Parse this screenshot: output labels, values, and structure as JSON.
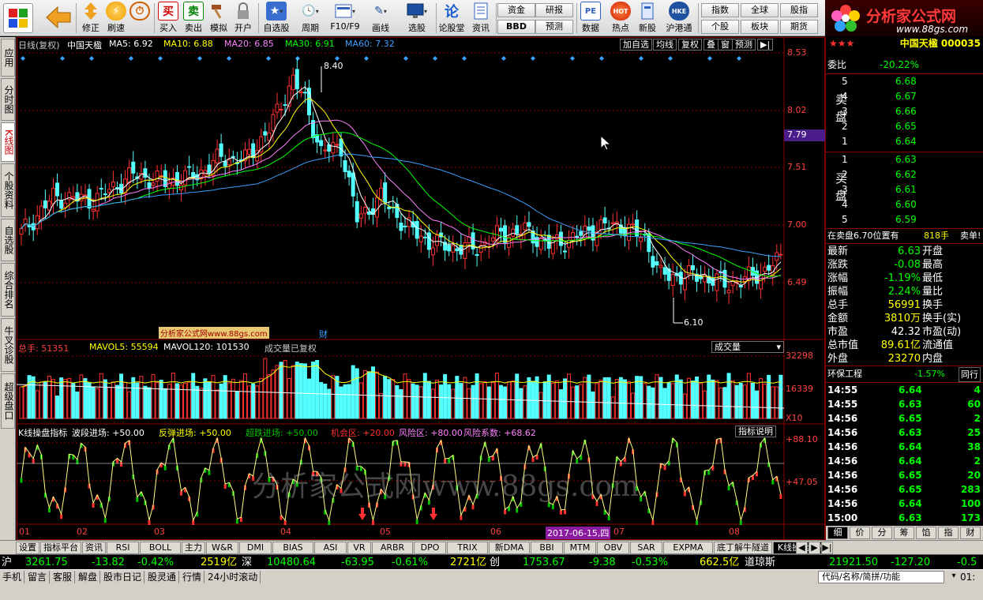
{
  "toolbar": {
    "buttons": [
      {
        "label": "修正",
        "icon": "up-arrow-icon"
      },
      {
        "label": "刷速",
        "icon": "lightning-icon"
      },
      {
        "label": "买入",
        "icon": "buy-icon",
        "glyph": "买"
      },
      {
        "label": "卖出",
        "icon": "sell-icon",
        "glyph": "卖"
      },
      {
        "label": "模拟",
        "icon": "hammer-icon"
      },
      {
        "label": "开户",
        "icon": "lock-icon"
      },
      {
        "label": "自选股",
        "icon": "star-icon"
      },
      {
        "label": "周期",
        "icon": "clock-icon"
      },
      {
        "label": "F10/F9",
        "icon": "document-icon"
      },
      {
        "label": "画线",
        "icon": "pen-icon"
      },
      {
        "label": "选股",
        "icon": "monitor-icon"
      },
      {
        "label": "论股堂",
        "icon": "forum-icon",
        "glyph": "论"
      },
      {
        "label": "资讯",
        "icon": "news-icon"
      },
      {
        "label": "数据",
        "icon": "pe-icon",
        "glyph": "PE"
      },
      {
        "label": "热点",
        "icon": "hot-icon",
        "glyph": "HOT"
      },
      {
        "label": "新股",
        "icon": "new-stock-icon"
      },
      {
        "label": "沪港通",
        "icon": "hk-connect-icon",
        "glyph": "HKE"
      }
    ],
    "small_buttons": [
      "资金",
      "研报",
      "BBD",
      "预测",
      "指数",
      "全球",
      "股指",
      "个股",
      "板块",
      "期货"
    ],
    "logo_title": "分析家公式网",
    "logo_url": "www.88gs.com"
  },
  "left_tabs": [
    "应用",
    "分时图",
    "K线图",
    "个股资料",
    "自选股",
    "综合排名",
    "牛叉诊股",
    "超级盘口"
  ],
  "chart": {
    "header": {
      "mode": "日线(复权)",
      "name": "中国天楹",
      "ma5": "MA5: 6.92",
      "ma10": "MA10: 6.88",
      "ma20": "MA20: 6.85",
      "ma30": "MA30: 6.91",
      "ma60": "MA60: 7.32"
    },
    "header_buttons": [
      "加自选",
      "均线",
      "复权",
      "叠",
      "窗",
      "预测"
    ],
    "price_axis": [
      "8.53",
      "8.02",
      "7.51",
      "7.00",
      "6.49"
    ],
    "current_price_tag": "7.79",
    "high_label": "8.40",
    "low_label": "6.10",
    "watermark_box": "分析家公式网www.88gs.com",
    "finance_marker": "财",
    "volume": {
      "total": "总手: 51351",
      "mavol5": "MAVOL5: 55594",
      "mavol120": "MAVOL120: 101530",
      "note": "成交量已复权",
      "selector": "成交量",
      "axis": [
        "32298",
        "16339",
        "X10"
      ]
    },
    "indicator": {
      "name": "K线操盘指标",
      "wave": "波段进场: +50.00",
      "rebound": "反弹进场: +50.00",
      "super": "超跌进场: +50.00",
      "chance": "机会区: +20.00",
      "risk": "风险区: +80.00",
      "coef": "风险系数: +68.62",
      "help": "指标说明",
      "axis": [
        "+88.10",
        "+47.05"
      ],
      "watermark": "分析家公式网www.88gs.com"
    },
    "x_axis": [
      "01",
      "02",
      "03",
      "04",
      "05",
      "06",
      "07",
      "08"
    ],
    "cursor_date": "2017-06-15,四"
  },
  "chart_data": {
    "type": "candlestick",
    "symbol": "中国天楹",
    "ylim": [
      6.0,
      8.6
    ],
    "high": 8.4,
    "low": 6.1,
    "ma": {
      "MA5": 6.92,
      "MA10": 6.88,
      "MA20": 6.85,
      "MA30": 6.91,
      "MA60": 7.32
    }
  },
  "right_panel": {
    "title": "中国天楹 000035",
    "weibi_label": "委比",
    "weibi_value": "-20.22%",
    "sell_label": "卖盘",
    "buy_label": "买盘",
    "asks": [
      {
        "level": "5",
        "price": "6.68"
      },
      {
        "level": "4",
        "price": "6.67"
      },
      {
        "level": "3",
        "price": "6.66"
      },
      {
        "level": "2",
        "price": "6.65"
      },
      {
        "level": "1",
        "price": "6.64"
      }
    ],
    "bids": [
      {
        "level": "1",
        "price": "6.63"
      },
      {
        "level": "2",
        "price": "6.62"
      },
      {
        "level": "3",
        "price": "6.61"
      },
      {
        "level": "4",
        "price": "6.60"
      },
      {
        "level": "5",
        "price": "6.59"
      }
    ],
    "notice": "在卖盘6.70位置有",
    "notice_qty": "818手",
    "notice_tail": "卖单!",
    "stats": [
      {
        "label": "最新",
        "value": "6.63",
        "label2": "开盘"
      },
      {
        "label": "涨跌",
        "value": "-0.08",
        "label2": "最高"
      },
      {
        "label": "涨幅",
        "value": "-1.19%",
        "label2": "最低"
      },
      {
        "label": "振幅",
        "value": "2.24%",
        "label2": "量比"
      },
      {
        "label": "总手",
        "value": "56991",
        "label2": "换手"
      },
      {
        "label": "金额",
        "value": "3810万",
        "label2": "换手(实)"
      },
      {
        "label": "市盈",
        "value": "42.32",
        "label2": "市盈(动)"
      },
      {
        "label": "总市值",
        "value": "89.61亿",
        "label2": "流通值"
      },
      {
        "label": "外盘",
        "value": "23270",
        "label2": "内盘"
      }
    ],
    "sector_name": "环保工程",
    "sector_change": "-1.57%",
    "sector_tail": "同行",
    "ticks": [
      {
        "time": "14:55",
        "price": "6.64",
        "vol": "4"
      },
      {
        "time": "14:55",
        "price": "6.63",
        "vol": "60"
      },
      {
        "time": "14:56",
        "price": "6.65",
        "vol": "2"
      },
      {
        "time": "14:56",
        "price": "6.63",
        "vol": "25"
      },
      {
        "time": "14:56",
        "price": "6.64",
        "vol": "38"
      },
      {
        "time": "14:56",
        "price": "6.64",
        "vol": "2"
      },
      {
        "time": "14:56",
        "price": "6.65",
        "vol": "20"
      },
      {
        "time": "14:56",
        "price": "6.65",
        "vol": "283"
      },
      {
        "time": "14:56",
        "price": "6.64",
        "vol": "100"
      },
      {
        "time": "15:00",
        "price": "6.63",
        "vol": "173"
      }
    ],
    "bottom_tabs": [
      "细",
      "价",
      "分",
      "筹",
      "馅",
      "指",
      "财"
    ]
  },
  "bottom_tabs": [
    "设置",
    "指标平台",
    "资讯",
    "RSI",
    "BOLL",
    "主力",
    "W&R",
    "DMI",
    "BIAS",
    "ASI",
    "VR",
    "ARBR",
    "DPO",
    "TRIX",
    "新DMA",
    "BBI",
    "MTM",
    "OBV",
    "SAR",
    "EXPMA",
    "底丁解牛隧道",
    "K线操盘指标"
  ],
  "index_bar": {
    "sh_label": "沪",
    "sh_value": "3261.75",
    "sh_change": "-13.82",
    "sh_pct": "-0.42%",
    "sh_amount": "2519亿",
    "sz_label": "深",
    "sz_value": "10480.64",
    "sz_change": "-63.95",
    "sz_pct": "-0.61%",
    "sz_amount": "2721亿",
    "cy_label": "创",
    "cy_value": "1753.67",
    "cy_change": "-9.38",
    "cy_pct": "-0.53%",
    "cy_amount": "662.5亿",
    "dj_label": "道琼斯",
    "dj_value": "21921.50",
    "dj_change": "-127.20",
    "dj_pct": "-0.5"
  },
  "status_bar": {
    "items": [
      "手机",
      "留言",
      "客服",
      "解盘",
      "股市日记",
      "股灵通",
      "行情",
      "24小时滚动"
    ],
    "code_placeholder": "代码/名称/简拼/功能",
    "time": "01:"
  },
  "colors": {
    "up": "#ff3030",
    "down": "#54ffff",
    "ma5": "#ffffff",
    "ma10": "#ffff00",
    "ma20": "#ff80ff",
    "ma30": "#00ff00",
    "ma60": "#3aa0ff",
    "grid": "#8b0000"
  }
}
